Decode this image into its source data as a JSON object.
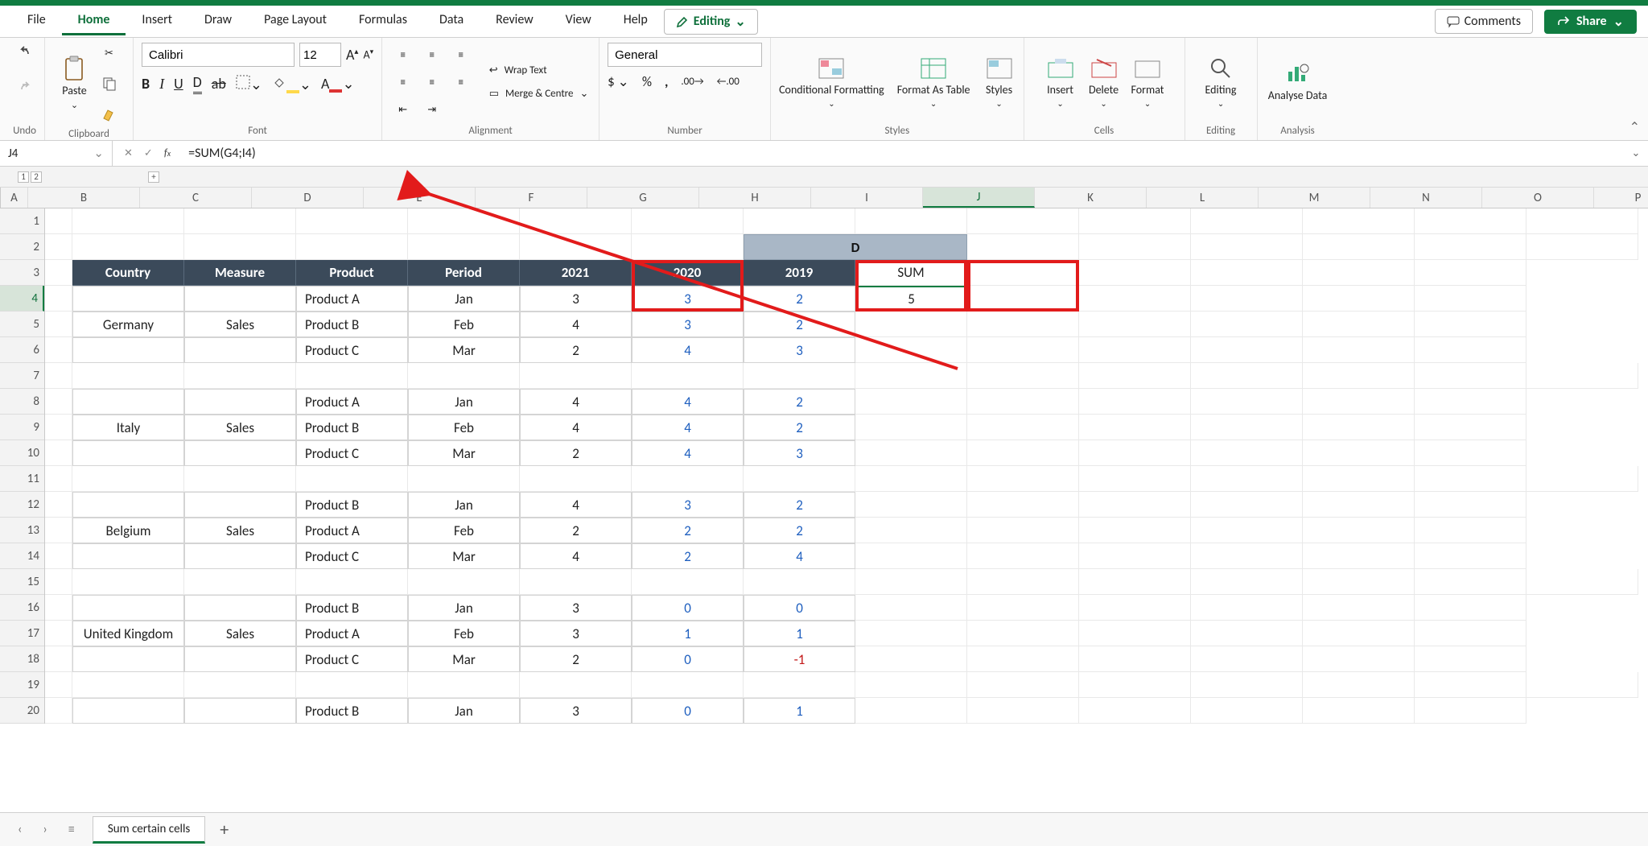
{
  "menu": {
    "file": "File",
    "home": "Home",
    "insert": "Insert",
    "draw": "Draw",
    "page_layout": "Page Layout",
    "formulas": "Formulas",
    "data": "Data",
    "review": "Review",
    "view": "View",
    "help": "Help"
  },
  "title_buttons": {
    "editing": "Editing",
    "comments": "Comments",
    "share": "Share"
  },
  "ribbon": {
    "undo_label": "Undo",
    "clipboard": {
      "paste": "Paste",
      "label": "Clipboard"
    },
    "font": {
      "name": "Calibri",
      "size": "12",
      "label": "Font"
    },
    "alignment": {
      "wrap": "Wrap Text",
      "merge": "Merge & Centre",
      "label": "Alignment"
    },
    "number": {
      "format": "General",
      "label": "Number"
    },
    "styles": {
      "cond": "Conditional Formatting",
      "fmt_as": "Format As Table",
      "styles": "Styles",
      "label": "Styles"
    },
    "cells": {
      "insert": "Insert",
      "delete": "Delete",
      "format": "Format",
      "label": "Cells"
    },
    "editing": {
      "label": "Editing",
      "btn": "Editing"
    },
    "analysis": {
      "btn": "Analyse Data",
      "label": "Analysis"
    }
  },
  "namebox": "J4",
  "formula": "=SUM(G4;I4)",
  "columns": [
    "A",
    "B",
    "C",
    "D",
    "E",
    "F",
    "G",
    "H",
    "I",
    "J",
    "K",
    "L",
    "M",
    "N",
    "O",
    "P"
  ],
  "groupD": "D",
  "headers": {
    "country": "Country",
    "measure": "Measure",
    "product": "Product",
    "period": "Period",
    "y2021": "2021",
    "y2020": "2020",
    "y2019": "2019",
    "sum": "SUM"
  },
  "blocks": [
    {
      "country": "Germany",
      "measure": "Sales",
      "rows": [
        {
          "product": "Product A",
          "period": "Jan",
          "y2021": "3",
          "y2020": "3",
          "y2019": "2",
          "sum": "5"
        },
        {
          "product": "Product B",
          "period": "Feb",
          "y2021": "4",
          "y2020": "3",
          "y2019": "2"
        },
        {
          "product": "Product C",
          "period": "Mar",
          "y2021": "2",
          "y2020": "4",
          "y2019": "3"
        }
      ]
    },
    {
      "country": "Italy",
      "measure": "Sales",
      "rows": [
        {
          "product": "Product A",
          "period": "Jan",
          "y2021": "4",
          "y2020": "4",
          "y2019": "2"
        },
        {
          "product": "Product B",
          "period": "Feb",
          "y2021": "4",
          "y2020": "4",
          "y2019": "2"
        },
        {
          "product": "Product C",
          "period": "Mar",
          "y2021": "2",
          "y2020": "4",
          "y2019": "3"
        }
      ]
    },
    {
      "country": "Belgium",
      "measure": "Sales",
      "rows": [
        {
          "product": "Product B",
          "period": "Jan",
          "y2021": "4",
          "y2020": "3",
          "y2019": "2"
        },
        {
          "product": "Product A",
          "period": "Feb",
          "y2021": "2",
          "y2020": "2",
          "y2019": "2"
        },
        {
          "product": "Product C",
          "period": "Mar",
          "y2021": "4",
          "y2020": "2",
          "y2019": "4"
        }
      ]
    },
    {
      "country": "United Kingdom",
      "measure": "Sales",
      "rows": [
        {
          "product": "Product B",
          "period": "Jan",
          "y2021": "3",
          "y2020": "0",
          "y2019": "0"
        },
        {
          "product": "Product A",
          "period": "Feb",
          "y2021": "3",
          "y2020": "1",
          "y2019": "1"
        },
        {
          "product": "Product C",
          "period": "Mar",
          "y2021": "2",
          "y2020": "0",
          "y2019": "-1",
          "neg": true
        }
      ]
    },
    {
      "country": "",
      "measure": "",
      "rows": [
        {
          "product": "Product B",
          "period": "Jan",
          "y2021": "3",
          "y2020": "0",
          "y2019": "1"
        }
      ]
    }
  ],
  "sheet_tab": "Sum certain cells",
  "outline": {
    "l1": "1",
    "l2": "2",
    "plus": "+"
  }
}
